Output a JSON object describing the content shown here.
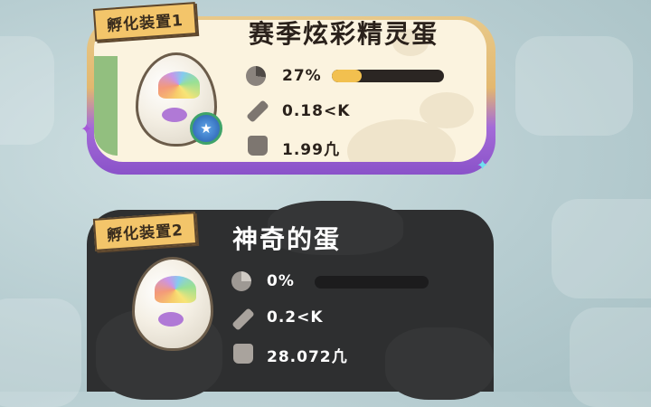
{
  "colors": {
    "card1_bg": "#fbf3df",
    "card1_border_top": "#e3b86f",
    "card1_border_bottom": "#8a52c9",
    "card2_bg": "#2e2f30",
    "progress_fill": "#f2c04f",
    "progress_track": "#2b2623",
    "badge_bg": "#f3c56a",
    "accent_sparkle_purple": "#a558d8",
    "accent_sparkle_cyan": "#6fe0f0"
  },
  "incubators": [
    {
      "badge": "孵化装置1",
      "egg_name": "赛季炫彩精灵蛋",
      "progress_text": "27%",
      "progress": 0.27,
      "distance": "0.18<K",
      "weight": "1.99​凢",
      "icons": [
        "pie-progress-icon",
        "ruler-icon",
        "weight-icon"
      ],
      "has_medal": true
    },
    {
      "badge": "孵化装置2",
      "egg_name": "神奇的蛋",
      "progress_text": "0%",
      "progress": 0,
      "distance": "0.2<K",
      "weight": "28.072凢",
      "icons": [
        "pie-progress-icon",
        "ruler-icon",
        "weight-icon"
      ],
      "has_medal": false
    }
  ]
}
